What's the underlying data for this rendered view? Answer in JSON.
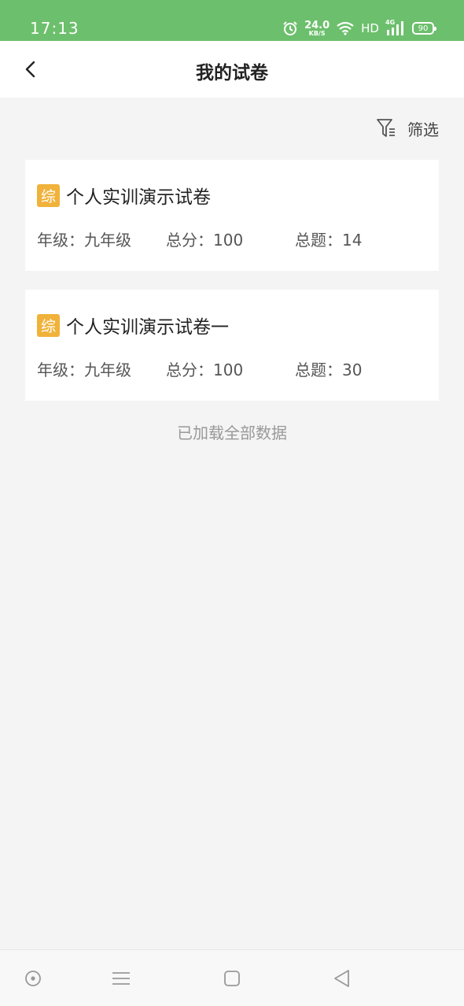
{
  "status_bar": {
    "time": "17:13",
    "net_speed_value": "24.0",
    "net_speed_unit": "KB/S",
    "hd": "HD",
    "network": "4G",
    "battery": "90",
    "icons": [
      "alarm-icon",
      "wifi-icon",
      "signal-icon",
      "battery-icon"
    ]
  },
  "header": {
    "title": "我的试卷",
    "back_icon": "chevron-left-icon"
  },
  "filter": {
    "label": "筛选",
    "icon": "filter-icon"
  },
  "papers": [
    {
      "tag": "综",
      "title": "个人实训演示试卷",
      "grade": "年级：九年级",
      "score": "总分：100",
      "count": "总题：14"
    },
    {
      "tag": "综",
      "title": "个人实训演示试卷一",
      "grade": "年级：九年级",
      "score": "总分：100",
      "count": "总题：30"
    }
  ],
  "list_footer": "已加载全部数据",
  "nav_bar": {
    "icons": [
      "assistant-icon",
      "menu-icon",
      "home-icon",
      "back-icon"
    ]
  },
  "colors": {
    "status_bar": "#6cbf6c",
    "tag": "#f0b23a",
    "background": "#f4f4f4"
  }
}
